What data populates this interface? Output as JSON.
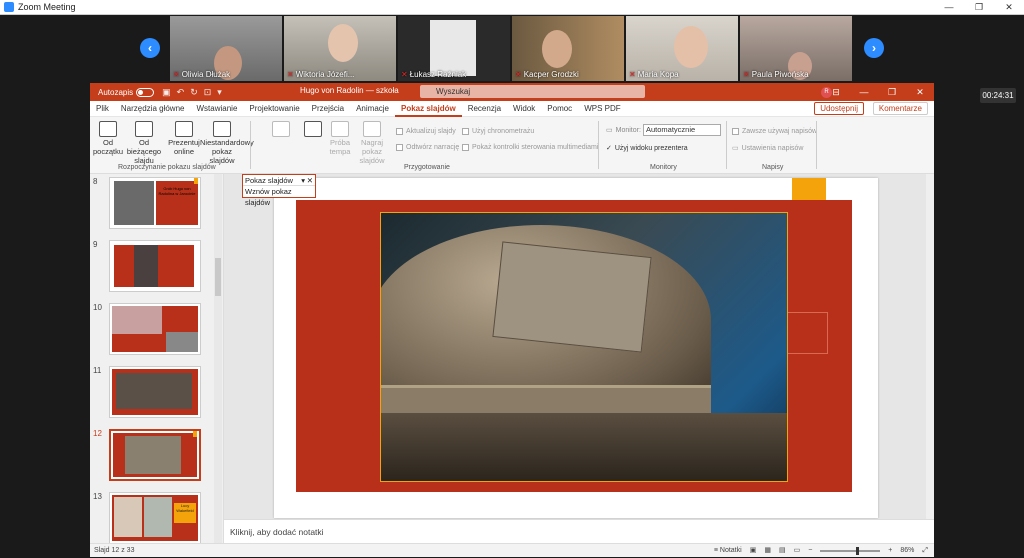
{
  "zoom": {
    "title": "Zoom Meeting",
    "timer": "00:24:31"
  },
  "participants": [
    {
      "name": "Oliwia Dłużak"
    },
    {
      "name": "Wiktoria Józefi..."
    },
    {
      "name": "Łukasz Raźniak"
    },
    {
      "name": "Kacper Grodzki"
    },
    {
      "name": "Maria Kopa"
    },
    {
      "name": "Paula Piwońska"
    }
  ],
  "ppt": {
    "autosave_label": "Autozapis",
    "doc_title": "Hugo von Radolin — szkoła",
    "search_placeholder": "Wyszukaj",
    "user_initial": "R",
    "tabs": [
      "Plik",
      "Narzędzia główne",
      "Wstawianie",
      "Projektowanie",
      "Przejścia",
      "Animacje",
      "Pokaz slajdów",
      "Recenzja",
      "Widok",
      "Pomoc",
      "WPS PDF"
    ],
    "share_label": "Udostępnij",
    "comments_label": "Komentarze",
    "ribbon": {
      "from_start": "Od początku",
      "from_current": "Od bieżącego slajdu",
      "present_online": "Prezentuj online",
      "custom_show": "Niestandardowy pokaz slajdów",
      "group_start": "Rozpoczynanie pokazu slajdów",
      "rehearse": "Próba tempa",
      "record": "Nagraj pokaz slajdów",
      "chk_update": "Aktualizuj slajdy",
      "chk_timings": "Użyj chronometrażu",
      "chk_narration": "Odtwórz narrację",
      "chk_media": "Pokaż kontrolki sterowania multimediami",
      "group_setup": "Przygotowanie",
      "monitor_label": "Monitor:",
      "monitor_value": "Automatycznie",
      "presenter_view": "Użyj widoku prezentera",
      "group_monitors": "Monitory",
      "chk_subtitles": "Zawsze używaj napisów",
      "subtitle_settings": "Ustawienia napisów",
      "group_captions": "Napisy"
    },
    "popup": {
      "selected": "Pokaz slajdów",
      "option": "Wznów pokaz slajdów"
    },
    "slides": [
      {
        "num": "8",
        "title": "Grób Hugo von Radolina w Jarocinie"
      },
      {
        "num": "9"
      },
      {
        "num": "10"
      },
      {
        "num": "11"
      },
      {
        "num": "12"
      },
      {
        "num": "13",
        "title": "Lucy Wakefield"
      }
    ],
    "notes_placeholder": "Kliknij, aby dodać notatki",
    "status": {
      "slide_label": "Slajd 12 z 33",
      "notes": "Notatki",
      "zoom": "86%"
    }
  }
}
